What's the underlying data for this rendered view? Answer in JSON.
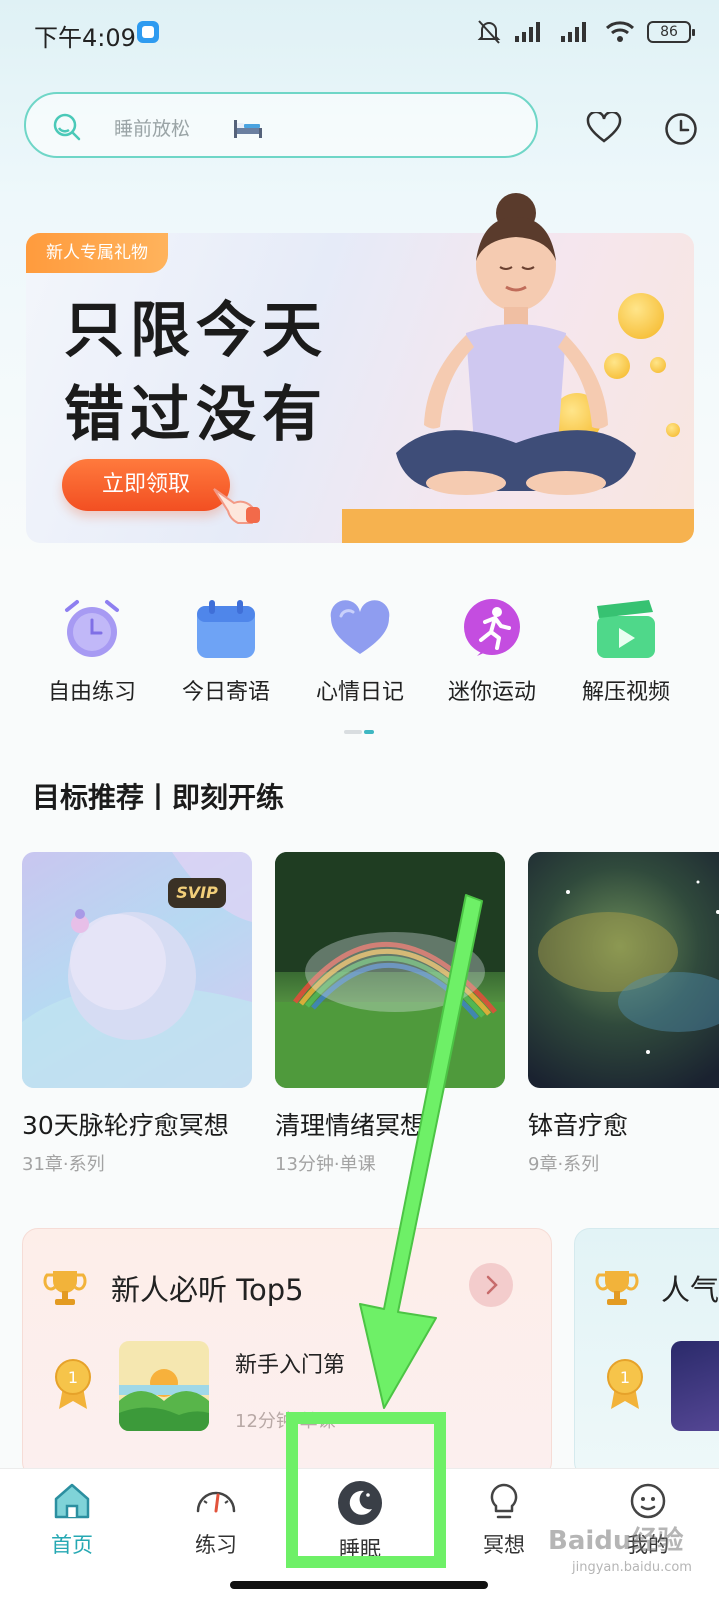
{
  "status_bar": {
    "time": "下午4:09",
    "battery": "86"
  },
  "search": {
    "placeholder": "睡前放松"
  },
  "banner": {
    "tag": "新人专属礼物",
    "headline_line1": "只限今天",
    "headline_line2": "错过没有",
    "cta": "立即领取"
  },
  "quick_entries": [
    {
      "label": "自由练习",
      "icon": "alarm-clock-icon",
      "color": "#9b8cf0"
    },
    {
      "label": "今日寄语",
      "icon": "calendar-icon",
      "color": "#5d95f2"
    },
    {
      "label": "心情日记",
      "icon": "heart-icon",
      "color": "#8a97ee"
    },
    {
      "label": "迷你运动",
      "icon": "running-icon",
      "color": "#c44de0"
    },
    {
      "label": "解压视频",
      "icon": "video-clapper-icon",
      "color": "#3fcf7a"
    }
  ],
  "section": {
    "title": "目标推荐丨即刻开练"
  },
  "courses": [
    {
      "title": "30天脉轮疗愈冥想",
      "meta": "31章·系列",
      "badge": "SVIP"
    },
    {
      "title": "清理情绪冥想",
      "meta": "13分钟·单课"
    },
    {
      "title": "钵音疗愈",
      "meta": "9章·系列"
    }
  ],
  "rankings": {
    "panel1": {
      "title": "新人必听 Top5",
      "item_title": "新手入门第",
      "item_meta": "12分钟·单课",
      "medal": "1"
    },
    "panel2": {
      "title": "人气",
      "medal": "1"
    }
  },
  "bottom_nav": [
    {
      "label": "首页",
      "icon": "home-icon",
      "active": true
    },
    {
      "label": "练习",
      "icon": "gauge-icon",
      "active": false
    },
    {
      "label": "睡眠",
      "icon": "moon-icon",
      "active": false
    },
    {
      "label": "冥想",
      "icon": "lightbulb-icon",
      "active": false
    },
    {
      "label": "我的",
      "icon": "profile-icon",
      "active": false
    }
  ],
  "watermark": {
    "brand": "Baidu经验",
    "url": "jingyan.baidu.com"
  },
  "colors": {
    "accent": "#25a8b3",
    "annotation": "#6ef067",
    "cta": "#f24f22"
  }
}
